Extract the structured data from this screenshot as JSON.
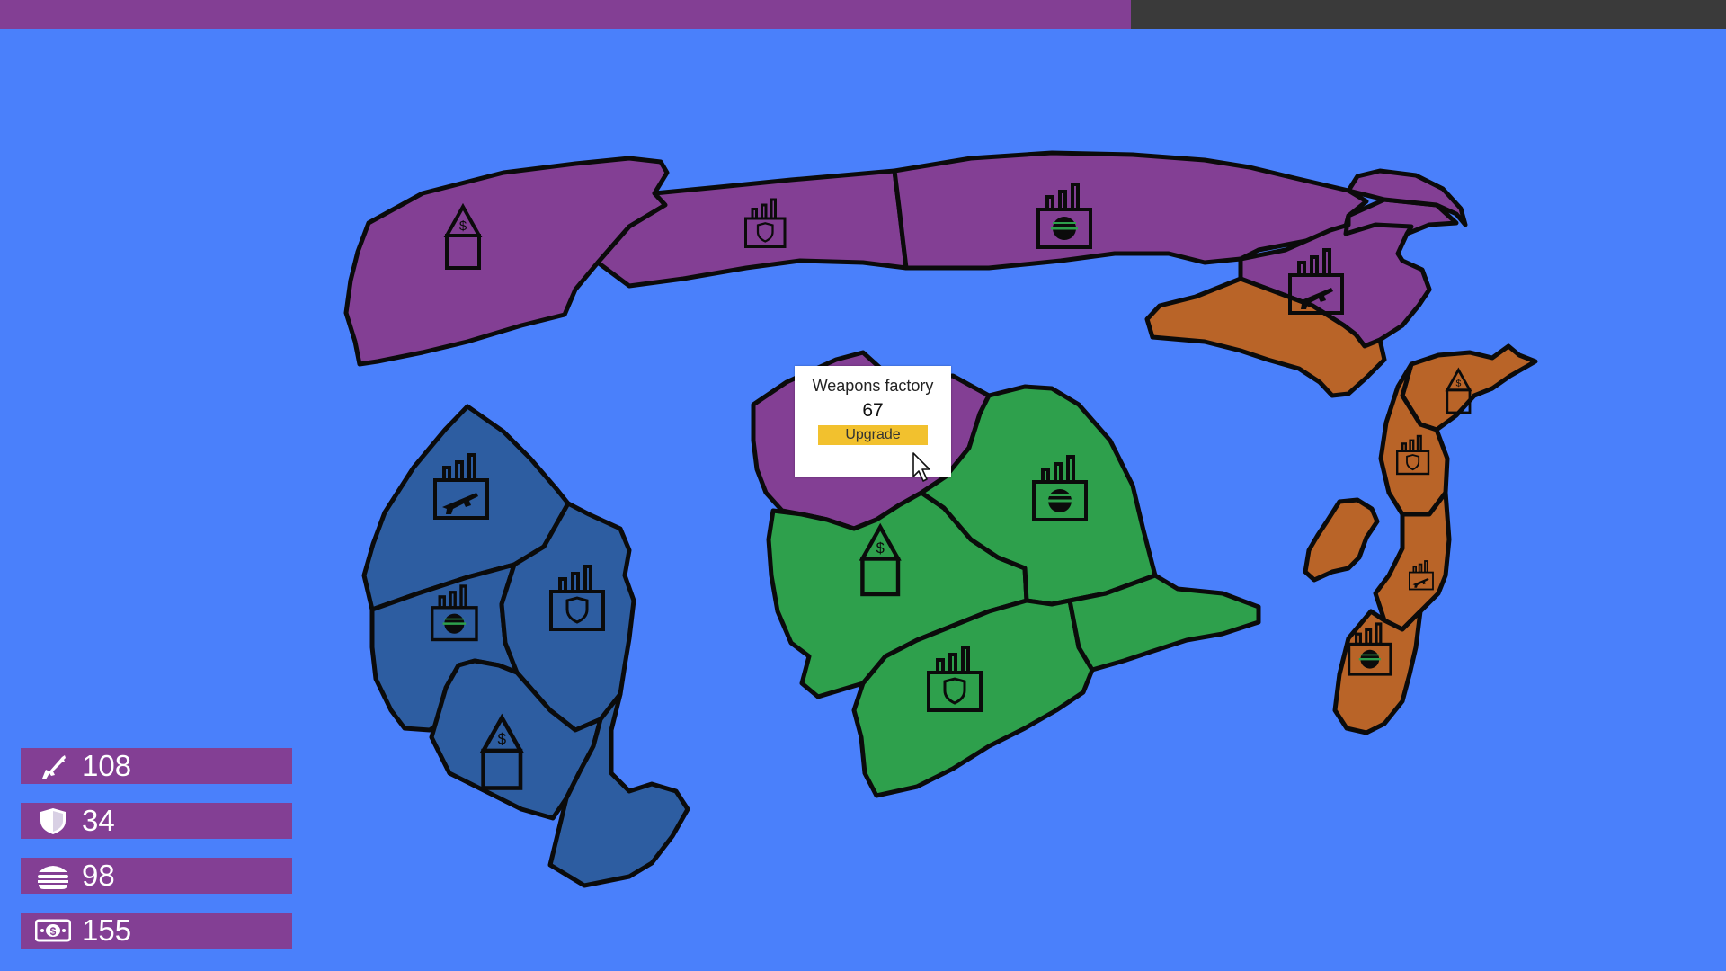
{
  "top_bar": {
    "progress": 0.655
  },
  "tooltip": {
    "title": "Weapons factory",
    "value": "67",
    "button_label": "Upgrade"
  },
  "resources": [
    {
      "name": "weapons",
      "icon": "rifle-icon",
      "value": "108"
    },
    {
      "name": "defense",
      "icon": "shield-icon",
      "value": "34"
    },
    {
      "name": "food",
      "icon": "burger-icon",
      "value": "98"
    },
    {
      "name": "money",
      "icon": "banknote-icon",
      "value": "155"
    }
  ],
  "colors": {
    "ocean": "#4a80fb",
    "purple_faction": "#833f94",
    "blue_faction": "#2d5da1",
    "green_faction": "#2ea04c",
    "orange_faction": "#b96428",
    "upgrade_button": "#f2c12e"
  },
  "buildings": [
    {
      "id": "bank-purple-west",
      "icon": "bank-icon"
    },
    {
      "id": "defense-factory-purple",
      "icon": "defense-factory-icon"
    },
    {
      "id": "food-factory-purple",
      "icon": "food-factory-icon"
    },
    {
      "id": "weapons-factory-purple-east",
      "icon": "weapons-factory-icon"
    },
    {
      "id": "weapons-factory-blue",
      "icon": "weapons-factory-icon"
    },
    {
      "id": "food-factory-blue",
      "icon": "food-factory-icon"
    },
    {
      "id": "defense-factory-blue",
      "icon": "defense-factory-icon"
    },
    {
      "id": "bank-blue",
      "icon": "bank-icon"
    },
    {
      "id": "bank-green",
      "icon": "bank-icon"
    },
    {
      "id": "food-factory-green",
      "icon": "food-factory-icon"
    },
    {
      "id": "defense-factory-green",
      "icon": "defense-factory-icon"
    },
    {
      "id": "bank-orange",
      "icon": "bank-icon"
    },
    {
      "id": "defense-factory-orange",
      "icon": "defense-factory-icon"
    },
    {
      "id": "weapons-factory-orange",
      "icon": "weapons-factory-icon"
    },
    {
      "id": "food-factory-orange",
      "icon": "food-factory-icon"
    }
  ]
}
